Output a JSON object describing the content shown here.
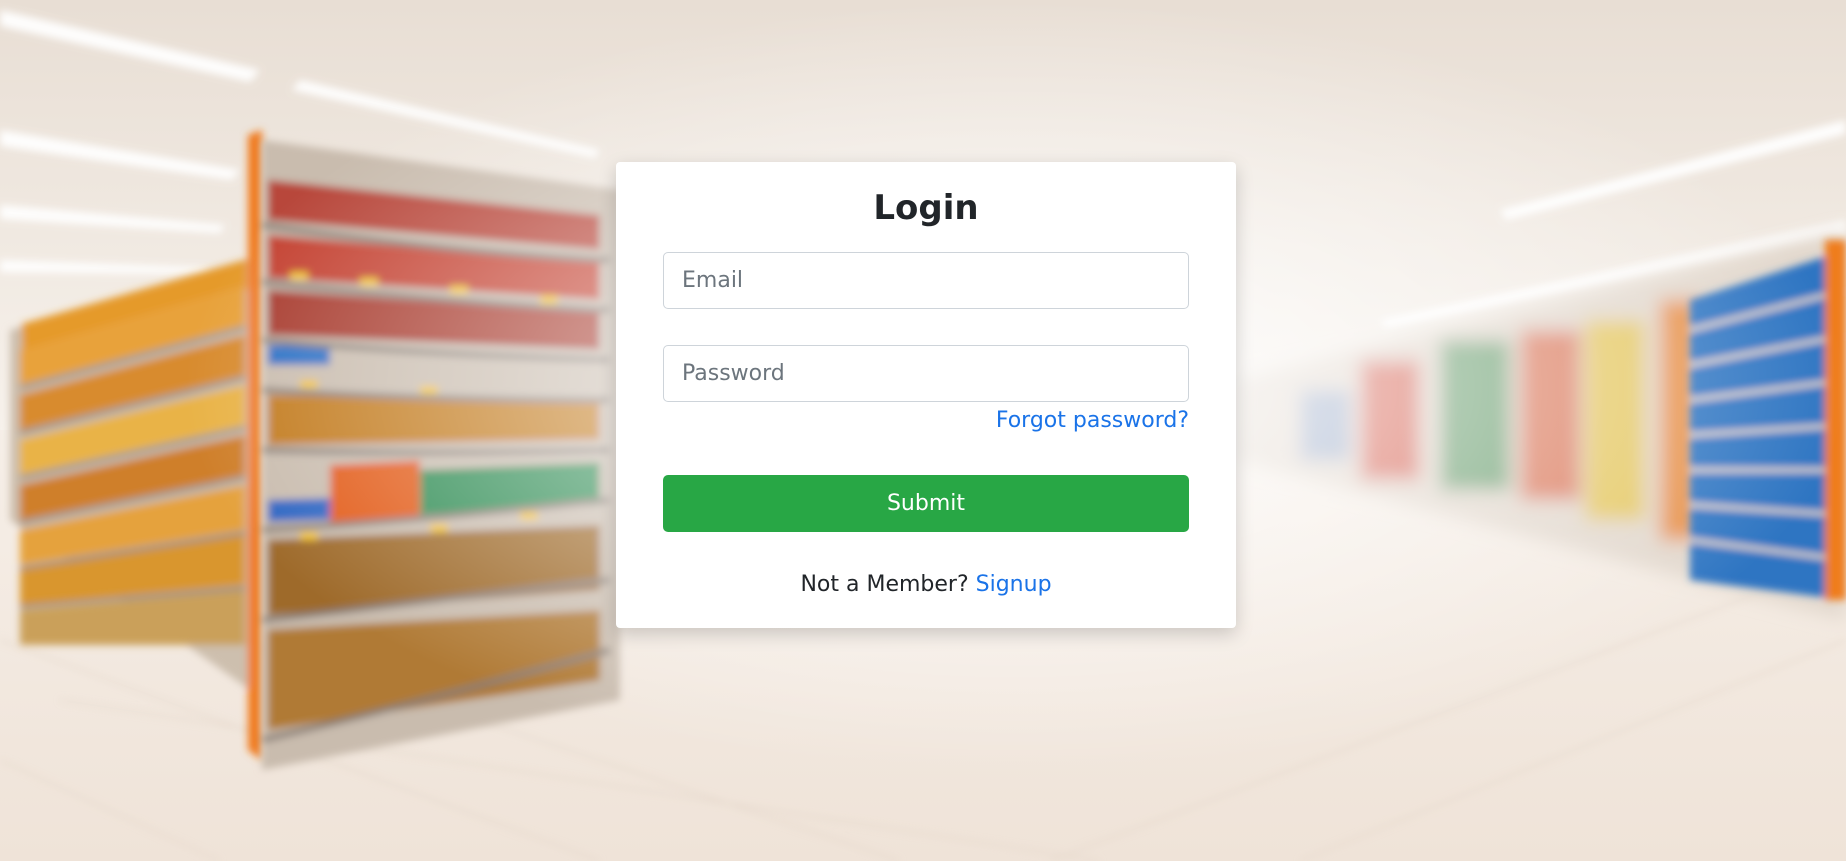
{
  "page": {
    "background_image": "blurred-supermarket-aisle"
  },
  "login": {
    "title": "Login",
    "email_placeholder": "Email",
    "email_value": "",
    "password_placeholder": "Password",
    "password_value": "",
    "forgot_label": "Forgot password?",
    "submit_label": "Submit",
    "member_prompt": "Not a Member?",
    "signup_label": "Signup"
  },
  "colors": {
    "submit_bg": "#28a745",
    "link": "#1a73e8",
    "text": "#212529"
  }
}
